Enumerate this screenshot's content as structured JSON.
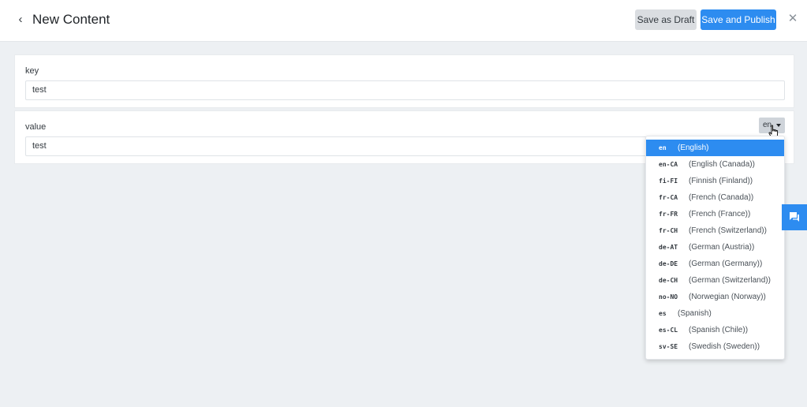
{
  "header": {
    "title": "New Content",
    "save_draft_label": "Save as Draft",
    "save_publish_label": "Save and Publish"
  },
  "fields": {
    "key": {
      "label": "key",
      "value": "test"
    },
    "value": {
      "label": "value",
      "value": "test",
      "locale": "en"
    }
  },
  "locales": [
    {
      "code": "en",
      "name": "(English)",
      "active": true
    },
    {
      "code": "en-CA",
      "name": "(English (Canada))"
    },
    {
      "code": "fi-FI",
      "name": "(Finnish (Finland))"
    },
    {
      "code": "fr-CA",
      "name": "(French (Canada))"
    },
    {
      "code": "fr-FR",
      "name": "(French (France))"
    },
    {
      "code": "fr-CH",
      "name": "(French (Switzerland))"
    },
    {
      "code": "de-AT",
      "name": "(German (Austria))"
    },
    {
      "code": "de-DE",
      "name": "(German (Germany))"
    },
    {
      "code": "de-CH",
      "name": "(German (Switzerland))"
    },
    {
      "code": "no-NO",
      "name": "(Norwegian (Norway))"
    },
    {
      "code": "es",
      "name": "(Spanish)"
    },
    {
      "code": "es-CL",
      "name": "(Spanish (Chile))"
    },
    {
      "code": "sv-SE",
      "name": "(Swedish (Sweden))"
    }
  ],
  "colors": {
    "accent": "#2d8cf0",
    "background": "#edf0f3",
    "draft_button": "#dadde1"
  },
  "icons": {
    "back": "chevron-left-icon",
    "close": "close-icon",
    "chat": "chat-icon",
    "caret": "caret-down-icon"
  }
}
